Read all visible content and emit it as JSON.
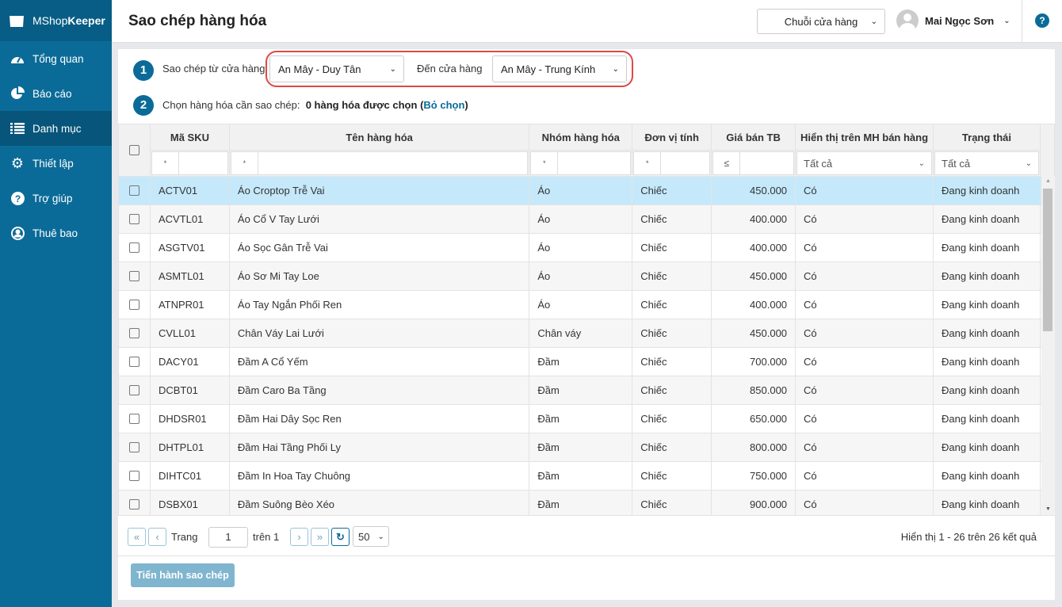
{
  "brand": {
    "name_light": "MShop",
    "name_bold": "Keeper"
  },
  "sidebar": {
    "items": [
      {
        "label": "Tổng quan",
        "icon": "dashboard-icon"
      },
      {
        "label": "Báo cáo",
        "icon": "pie-chart-icon"
      },
      {
        "label": "Danh mục",
        "icon": "list-icon",
        "active": true
      },
      {
        "label": "Thiết lập",
        "icon": "gear-icon"
      },
      {
        "label": "Trợ giúp",
        "icon": "help-icon"
      },
      {
        "label": "Thuê bao",
        "icon": "user-icon"
      }
    ]
  },
  "header": {
    "title": "Sao chép hàng hóa",
    "chain_button": "Chuỗi cửa hàng",
    "user_name": "Mai Ngọc Sơn",
    "help": "?"
  },
  "form": {
    "step1": "1",
    "step2": "2",
    "from_label": "Sao chép từ cửa hàng",
    "from_value": "An Mây - Duy Tân",
    "to_label": "Đến cửa hàng",
    "to_value": "An Mây - Trung Kính",
    "choose_label": "Chọn hàng hóa cần sao chép:",
    "selected_count": "0 hàng hóa được chọn",
    "clear_open": "(",
    "clear_link": "Bỏ chọn",
    "clear_close": ")"
  },
  "table": {
    "columns": [
      "Mã SKU",
      "Tên hàng hóa",
      "Nhóm hàng hóa",
      "Đơn vị tính",
      "Giá bán TB",
      "Hiển thị trên MH bán hàng",
      "Trạng thái"
    ],
    "filters": {
      "sku_op": "*",
      "name_op": "*",
      "group_op": "*",
      "unit_op": "*",
      "price_op": "≤",
      "display": "Tất cả",
      "status": "Tất cả"
    },
    "rows": [
      [
        "ACTV01",
        "Áo Croptop Trễ Vai",
        "Áo",
        "Chiếc",
        "450.000",
        "Có",
        "Đang kinh doanh"
      ],
      [
        "ACVTL01",
        "Áo Cổ V Tay Lưới",
        "Áo",
        "Chiếc",
        "400.000",
        "Có",
        "Đang kinh doanh"
      ],
      [
        "ASGTV01",
        "Áo Sọc Gân Trễ Vai",
        "Áo",
        "Chiếc",
        "400.000",
        "Có",
        "Đang kinh doanh"
      ],
      [
        "ASMTL01",
        "Áo Sơ Mi Tay Loe",
        "Áo",
        "Chiếc",
        "450.000",
        "Có",
        "Đang kinh doanh"
      ],
      [
        "ATNPR01",
        "Áo Tay Ngắn Phối Ren",
        "Áo",
        "Chiếc",
        "400.000",
        "Có",
        "Đang kinh doanh"
      ],
      [
        "CVLL01",
        "Chân Váy Lai Lưới",
        "Chân váy",
        "Chiếc",
        "450.000",
        "Có",
        "Đang kinh doanh"
      ],
      [
        "DACY01",
        "Đầm A Cổ Yếm",
        "Đầm",
        "Chiếc",
        "700.000",
        "Có",
        "Đang kinh doanh"
      ],
      [
        "DCBT01",
        "Đầm Caro Ba Tầng",
        "Đầm",
        "Chiếc",
        "850.000",
        "Có",
        "Đang kinh doanh"
      ],
      [
        "DHDSR01",
        "Đầm Hai Dây Sọc Ren",
        "Đầm",
        "Chiếc",
        "650.000",
        "Có",
        "Đang kinh doanh"
      ],
      [
        "DHTPL01",
        "Đầm Hai Tầng Phối Ly",
        "Đầm",
        "Chiếc",
        "800.000",
        "Có",
        "Đang kinh doanh"
      ],
      [
        "DIHTC01",
        "Đầm In Hoa Tay Chuông",
        "Đầm",
        "Chiếc",
        "750.000",
        "Có",
        "Đang kinh doanh"
      ],
      [
        "DSBX01",
        "Đầm Suông Bèo Xéo",
        "Đầm",
        "Chiếc",
        "900.000",
        "Có",
        "Đang kinh doanh"
      ]
    ]
  },
  "pager": {
    "page_label": "Trang",
    "page": "1",
    "of_label": "trên 1",
    "page_size": "50",
    "summary": "Hiển thị 1 - 26 trên 26 kết quả"
  },
  "actions": {
    "copy": "Tiến hành sao chép"
  }
}
